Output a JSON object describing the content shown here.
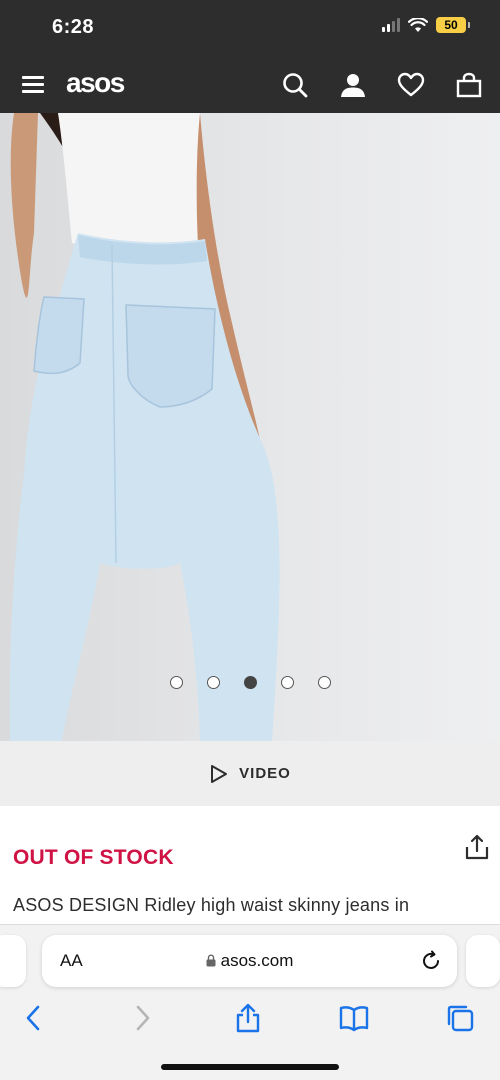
{
  "status_bar": {
    "time": "6:28",
    "battery": "50"
  },
  "header": {
    "logo": "asos",
    "icons": [
      "menu-icon",
      "search-icon",
      "account-icon",
      "heart-icon",
      "bag-icon"
    ]
  },
  "carousel": {
    "total": 5,
    "active_index": 2
  },
  "video": {
    "label": "VIDEO"
  },
  "product": {
    "stock_status": "OUT OF STOCK",
    "stock_color": "#d01345",
    "name": "ASOS DESIGN Ridley high waist skinny jeans in"
  },
  "safari": {
    "text_size_label": "AA",
    "url": "asos.com",
    "accent": "#1a73e8"
  }
}
